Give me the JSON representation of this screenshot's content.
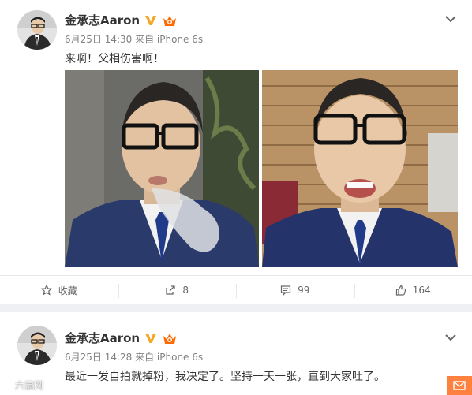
{
  "posts": [
    {
      "username": "金承志Aaron",
      "meta": "6月25日 14:30 来自 iPhone 6s",
      "text": "来啊！父相伤害啊！",
      "actions": {
        "favorite": "收藏",
        "repost": "8",
        "comment": "99",
        "like": "164"
      }
    },
    {
      "username": "金承志Aaron",
      "meta": "6月25日 14:28 来自 iPhone 6s",
      "text": "最近一发自拍就掉粉，我决定了。坚持一天一张，直到大家吐了。"
    }
  ],
  "watermark": "六鼠网"
}
